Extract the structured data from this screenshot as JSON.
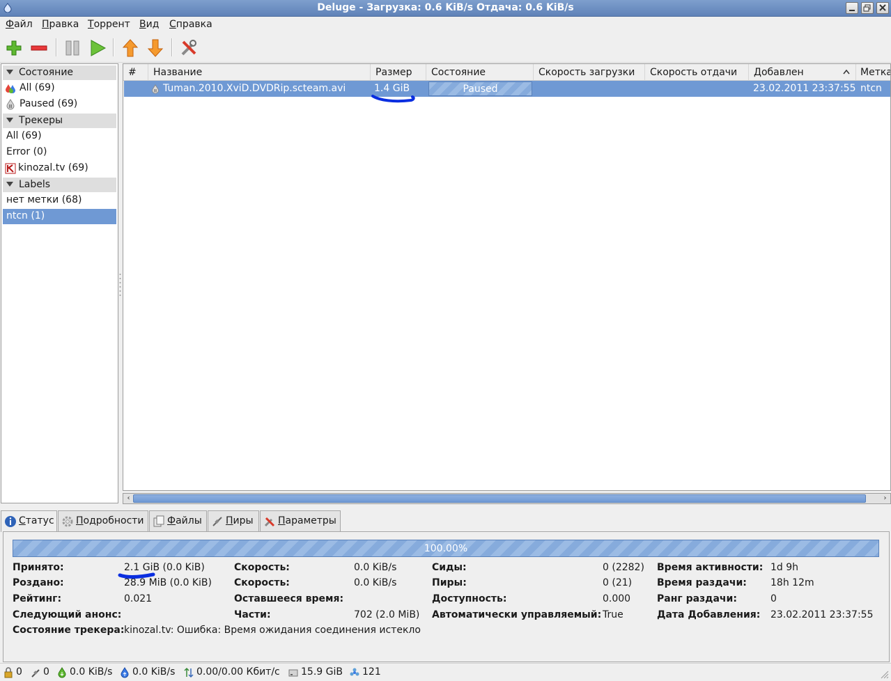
{
  "window": {
    "title": "Deluge - Загрузка: 0.6 KiB/s Отдача: 0.6 KiB/s",
    "controls": [
      "minimize",
      "maximize",
      "close"
    ]
  },
  "menu": [
    {
      "first": "Ф",
      "rest": "айл"
    },
    {
      "first": "П",
      "rest": "равка"
    },
    {
      "first": "Т",
      "rest": "оррент"
    },
    {
      "first": "В",
      "rest": "ид"
    },
    {
      "first": "С",
      "rest": "правка"
    }
  ],
  "toolbar": {
    "icons": [
      "add-icon",
      "remove-icon",
      "pause-icon",
      "resume-icon",
      "queue-up-icon",
      "queue-down-icon",
      "preferences-icon"
    ]
  },
  "sidebar": {
    "state_header": "Состояние",
    "state_items": [
      {
        "label": "All (69)",
        "icon": "all-states-icon"
      },
      {
        "label": "Paused (69)",
        "icon": "paused-state-icon"
      }
    ],
    "trackers_header": "Трекеры",
    "tracker_items": [
      {
        "label": "All (69)"
      },
      {
        "label": "Error (0)"
      },
      {
        "label": "kinozal.tv (69)",
        "icon": "kinozal-favicon-icon"
      }
    ],
    "labels_header": "Labels",
    "label_items": [
      {
        "label": "нет метки (68)"
      },
      {
        "label": "ntcn (1)",
        "selected": true
      }
    ]
  },
  "list": {
    "columns": [
      "#",
      "Название",
      "Размер",
      "Состояние",
      "Скорость загрузки",
      "Скорость отдачи",
      "Добавлен",
      "Метка"
    ],
    "sorted_column": "Добавлен",
    "rows": [
      {
        "num": "",
        "name": "Tuman.2010.XviD.DVDRip.scteam.avi",
        "size": "1.4 GiB",
        "state": "Paused",
        "down": "",
        "up": "",
        "added": "23.02.2011 23:37:55",
        "label": "ntcn"
      }
    ]
  },
  "tabs": [
    {
      "first": "С",
      "rest": "татус",
      "icon": "info-icon",
      "active": true
    },
    {
      "first": "П",
      "rest": "одробности",
      "icon": "details-gear-icon"
    },
    {
      "first": "Ф",
      "rest": "айлы",
      "icon": "files-icon"
    },
    {
      "first": "П",
      "rest": "иры",
      "icon": "peers-icon"
    },
    {
      "first": "П",
      "rest": "араметры",
      "icon": "options-icon"
    }
  ],
  "status": {
    "progress_text": "100.00%",
    "progress_fraction": 1.0,
    "fields": {
      "received_label": "Принято:",
      "received": "2.1 GiB (0.0 KiB)",
      "uploaded_label": "Роздано:",
      "uploaded": "28.9 MiB (0.0 KiB)",
      "ratio_label": "Рейтинг:",
      "ratio": "0.021",
      "next_announce_label": "Следующий анонс:",
      "tracker_status_label": "Состояние трекера:",
      "tracker_status": "kinozal.tv: Ошибка: Время ожидания соединения истекло",
      "down_speed_label": "Скорость:",
      "down_speed": "0.0 KiB/s",
      "up_speed_label": "Скорость:",
      "up_speed": "0.0 KiB/s",
      "eta_label": "Оставшееся время:",
      "pieces_label": "Части:",
      "pieces": "702 (2.0 MiB)",
      "seeds_label": "Сиды:",
      "seeds": "0 (2282)",
      "peers_label": "Пиры:",
      "peers": "0 (21)",
      "availability_label": "Доступность:",
      "availability": "0.000",
      "auto_managed_label": "Автоматически управляемый:",
      "auto_managed": "True",
      "active_time_label": "Время активности:",
      "active_time": "1d 9h",
      "seeding_time_label": "Время раздачи:",
      "seeding_time": "18h 12m",
      "seed_rank_label": "Ранг раздачи:",
      "seed_rank": "0",
      "date_added_label": "Дата Добавления:",
      "date_added": "23.02.2011 23:37:55"
    }
  },
  "statusbar": {
    "connections": "0",
    "dht": "0",
    "download": "0.0 KiB/s",
    "upload": "0.0 KiB/s",
    "protocol": "0.00/0.00 Кбит/с",
    "free_space": "15.9 GiB",
    "dht_nodes": "121"
  },
  "colors": {
    "selection": "#6f99d4",
    "title_bar": "#6f90c3",
    "annotation_ink": "#0a2ee0"
  }
}
